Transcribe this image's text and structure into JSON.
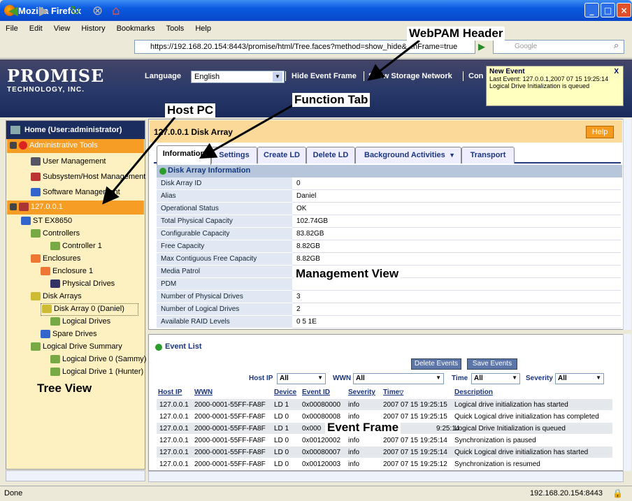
{
  "window": {
    "title": "Mozilla Firefox"
  },
  "menu": [
    "File",
    "Edit",
    "View",
    "History",
    "Bookmarks",
    "Tools",
    "Help"
  ],
  "browser": {
    "url": "https://192.168.20.154:8443/promise/html/Tree.faces?method=show_hide&...nFrame=true",
    "search_placeholder": "Google"
  },
  "header": {
    "logo_line1": "PROMISE",
    "logo_line2": "TECHNOLOGY, INC.",
    "language_label": "Language",
    "language_value": "English",
    "hide_event_frame": "Hide Event Frame",
    "show_storage_network": "Show Storage Network",
    "truncated": "Con"
  },
  "new_event": {
    "title": "New Event",
    "close": "X",
    "line1": "Last Event: 127.0.0.1,2007 07 15 19:25:14",
    "line2": "Logical Drive Initialization is queued"
  },
  "tree": {
    "header": "Home (User:administrator)",
    "items": [
      {
        "label": "Administrative Tools"
      },
      {
        "label": "User Management"
      },
      {
        "label": "Subsystem/Host Management"
      },
      {
        "label": "Software Management"
      },
      {
        "label": "127.0.0.1"
      },
      {
        "label": "ST EX8650"
      },
      {
        "label": "Controllers"
      },
      {
        "label": "Controller 1"
      },
      {
        "label": "Enclosures"
      },
      {
        "label": "Enclosure 1"
      },
      {
        "label": "Physical Drives"
      },
      {
        "label": "Disk Arrays"
      },
      {
        "label": "Disk Array 0 (Daniel)"
      },
      {
        "label": "Logical Drives"
      },
      {
        "label": "Spare Drives"
      },
      {
        "label": "Logical Drive Summary"
      },
      {
        "label": "Logical Drive 0 (Sammy)"
      },
      {
        "label": "Logical Drive 1 (Hunter)"
      }
    ]
  },
  "panel": {
    "title": "127.0.0.1 Disk Array",
    "help": "Help",
    "tabs": [
      "Information",
      "Settings",
      "Create LD",
      "Delete LD",
      "Background Activities",
      "Transport"
    ],
    "section_title": "Disk Array Information",
    "rows": [
      {
        "label": "Disk Array ID",
        "value": "0"
      },
      {
        "label": "Alias",
        "value": "Daniel"
      },
      {
        "label": "Operational Status",
        "value": "OK"
      },
      {
        "label": "Total Physical Capacity",
        "value": "102.74GB"
      },
      {
        "label": "Configurable Capacity",
        "value": "83.82GB"
      },
      {
        "label": "Free Capacity",
        "value": "8.82GB"
      },
      {
        "label": "Max Contiguous Free Capacity",
        "value": "8.82GB"
      },
      {
        "label": "Media Patrol",
        "value": ""
      },
      {
        "label": "PDM",
        "value": ""
      },
      {
        "label": "Number of Physical Drives",
        "value": "3"
      },
      {
        "label": "Number of Logical Drives",
        "value": "2"
      },
      {
        "label": "Available RAID Levels",
        "value": "0 5 1E"
      }
    ]
  },
  "events": {
    "title": "Event List",
    "delete_btn": "Delete Events",
    "save_btn": "Save Events",
    "filters": {
      "host_ip_label": "Host IP",
      "host_ip_value": "All",
      "wwn_label": "WWN",
      "wwn_value": "All",
      "time_label": "Time",
      "time_value": "All",
      "severity_label": "Severity",
      "severity_value": "All"
    },
    "columns": [
      "Host IP",
      "WWN",
      "Device",
      "Event ID",
      "Severity",
      "Time",
      "Description"
    ],
    "rows": [
      [
        "127.0.0.1",
        "2000-0001-55FF-FA8F",
        "LD 1",
        "0x00080000",
        "info",
        "2007 07 15 19:25:15",
        "Logical drive initialization has started"
      ],
      [
        "127.0.0.1",
        "2000-0001-55FF-FA8F",
        "LD 0",
        "0x00080008",
        "info",
        "2007 07 15 19:25:15",
        "Quick Logical drive initialization has completed"
      ],
      [
        "127.0.0.1",
        "2000-0001-55FF-FA8F",
        "LD 1",
        "0x000",
        "",
        "9:25:14",
        "Logical Drive Initialization is queued"
      ],
      [
        "127.0.0.1",
        "2000-0001-55FF-FA8F",
        "LD 0",
        "0x00120002",
        "info",
        "2007 07 15 19:25:14",
        "Synchronization is paused"
      ],
      [
        "127.0.0.1",
        "2000-0001-55FF-FA8F",
        "LD 0",
        "0x00080007",
        "info",
        "2007 07 15 19:25:14",
        "Quick Logical drive initialization has started"
      ],
      [
        "127.0.0.1",
        "2000-0001-55FF-FA8F",
        "LD 0",
        "0x00120003",
        "info",
        "2007 07 15 19:25:12",
        "Synchronization is resumed"
      ]
    ]
  },
  "status": {
    "left": "Done",
    "right": "192.168.20.154:8443"
  },
  "annotations": {
    "webpam": "WebPAM Header",
    "host_pc": "Host PC",
    "function_tab": "Function Tab",
    "management_view": "Management View",
    "tree_view": "Tree View",
    "event_frame": "Event Frame"
  }
}
